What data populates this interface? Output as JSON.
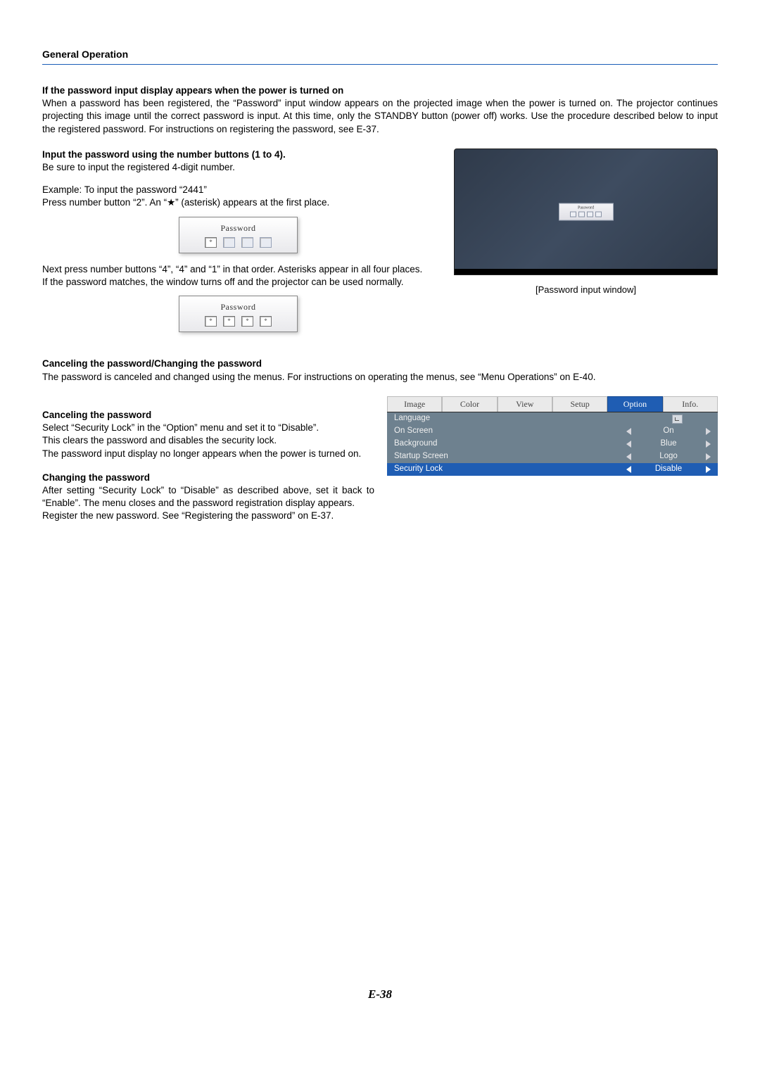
{
  "sectionTitle": "General Operation",
  "sub1": {
    "heading": "If the password input display appears when the power is turned on",
    "body": "When a password has been registered, the “Password” input window appears on the projected image when the power is turned on. The projector continues projecting this image until the correct password is input. At this time, only the STANDBY button (power off) works. Use the procedure described below to input the registered password. For instructions on registering the password, see E-37."
  },
  "sub2": {
    "heading": "Input the password using the number buttons (1 to 4).",
    "line1": "Be sure to input the registered 4-digit number.",
    "line2": "Example: To input the password “2441”",
    "line3": "Press number button “2”. An “★” (asterisk) appears at the first place.",
    "line4": "Next press number buttons “4”, “4” and “1” in that order. Asterisks appear in all four places.",
    "line5": "If the password matches, the window turns off and the projector can be used normally."
  },
  "pwd": {
    "label": "Password",
    "starChar": "*"
  },
  "screenCaption": "[Password input window]",
  "sub3": {
    "heading": "Canceling the password/Changing the password",
    "body": "The password is canceled and changed using the menus. For instructions on operating the menus, see “Menu Operations” on E-40."
  },
  "cancel": {
    "heading": "Canceling the password",
    "l1": "Select “Security Lock” in the “Option” menu and set it to “Disable”.",
    "l2": "This clears the password and disables the security lock.",
    "l3": "The password input display no longer appears when the power is turned on."
  },
  "change": {
    "heading": "Changing the password",
    "l1": "After setting “Security Lock” to “Disable” as described above, set it back to “Enable”. The menu closes and the password registration display appears.",
    "l2": "Register the new password. See “Registering the password” on E-37."
  },
  "osd": {
    "tabs": [
      "Image",
      "Color",
      "View",
      "Setup",
      "Option",
      "Info."
    ],
    "selectedTab": "Option",
    "rows": [
      {
        "label": "Language",
        "type": "enter"
      },
      {
        "label": "On Screen",
        "type": "arrows",
        "value": "On"
      },
      {
        "label": "Background",
        "type": "arrows",
        "value": "Blue"
      },
      {
        "label": "Startup Screen",
        "type": "arrows",
        "value": "Logo"
      },
      {
        "label": "Security Lock",
        "type": "arrows",
        "value": "Disable",
        "selected": true
      }
    ]
  },
  "pageNumber": "E-38"
}
